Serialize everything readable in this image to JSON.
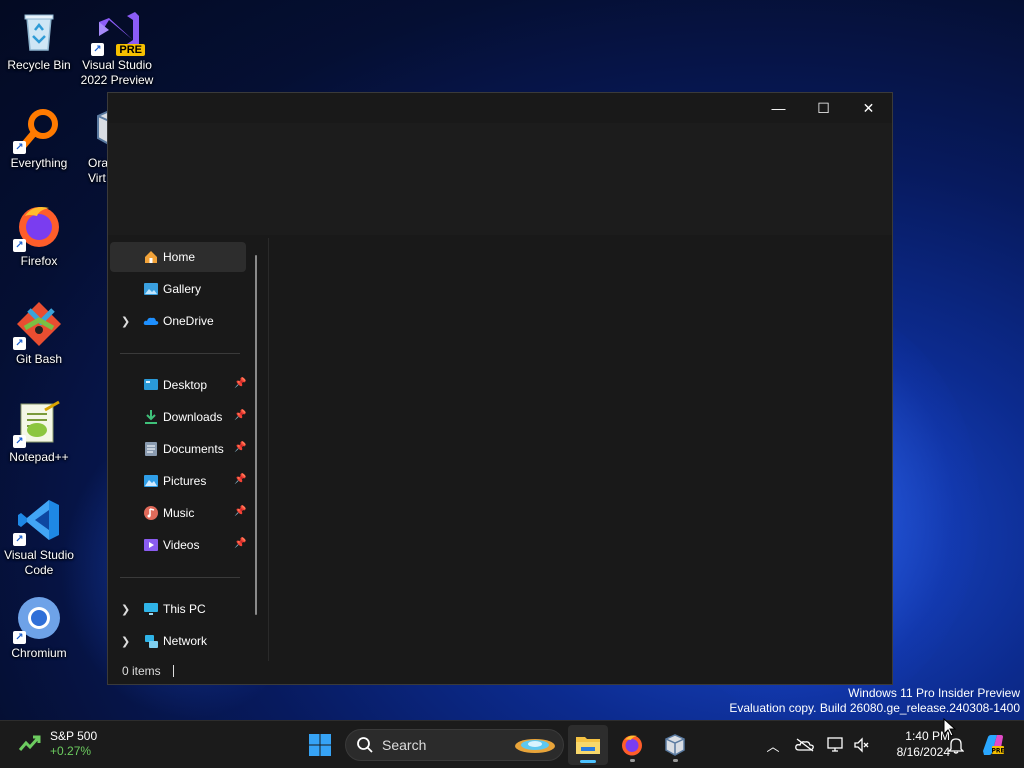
{
  "desktop": {
    "icons": [
      {
        "label": "Recycle Bin"
      },
      {
        "label": "Visual Studio 2022 Preview",
        "badge": "PRE"
      },
      {
        "label": "Everything"
      },
      {
        "label": "Oracle VirtualBox",
        "visible_label": "Ora Virt"
      },
      {
        "label": "Firefox"
      },
      {
        "label": "Git Bash"
      },
      {
        "label": "Notepad++"
      },
      {
        "label": "Visual Studio Code"
      },
      {
        "label": "Chromium"
      }
    ]
  },
  "window": {
    "controls": {
      "minimize": "—",
      "maximize": "☐",
      "close": "✕"
    },
    "nav": {
      "top": [
        {
          "label": "Home",
          "icon": "home-icon",
          "active": true
        },
        {
          "label": "Gallery",
          "icon": "gallery-icon"
        },
        {
          "label": "OneDrive",
          "icon": "onedrive-icon",
          "expandable": true
        }
      ],
      "quick_access": [
        {
          "label": "Desktop",
          "icon": "desktop-folder-icon",
          "pinned": true
        },
        {
          "label": "Downloads",
          "icon": "downloads-icon",
          "pinned": true
        },
        {
          "label": "Documents",
          "icon": "documents-icon",
          "pinned": true
        },
        {
          "label": "Pictures",
          "icon": "pictures-icon",
          "pinned": true
        },
        {
          "label": "Music",
          "icon": "music-icon",
          "pinned": true
        },
        {
          "label": "Videos",
          "icon": "videos-icon",
          "pinned": true
        }
      ],
      "bottom": [
        {
          "label": "This PC",
          "icon": "this-pc-icon",
          "expandable": true
        },
        {
          "label": "Network",
          "icon": "network-icon",
          "expandable": true
        }
      ]
    },
    "status": {
      "items": "0 items"
    }
  },
  "watermark": {
    "line1": "Windows 11 Pro Insider Preview",
    "line2": "Evaluation copy. Build 26080.ge_release.240308-1400"
  },
  "taskbar": {
    "widget": {
      "title": "S&P 500",
      "delta": "+0.27%"
    },
    "search_label": "Search",
    "clock": {
      "time": "1:40 PM",
      "date": "8/16/2024"
    },
    "apps": [
      "start-button",
      "file-explorer",
      "firefox",
      "virtualbox"
    ],
    "tray": [
      "show-hidden-icons",
      "onedrive-tray",
      "network-tray",
      "volume-tray",
      "notifications",
      "copilot"
    ]
  },
  "colors": {
    "accent": "#4cc2ff",
    "window_bg": "#191919",
    "taskbar_bg": "#1b1b1b",
    "delta_positive": "#6ccb5f"
  }
}
